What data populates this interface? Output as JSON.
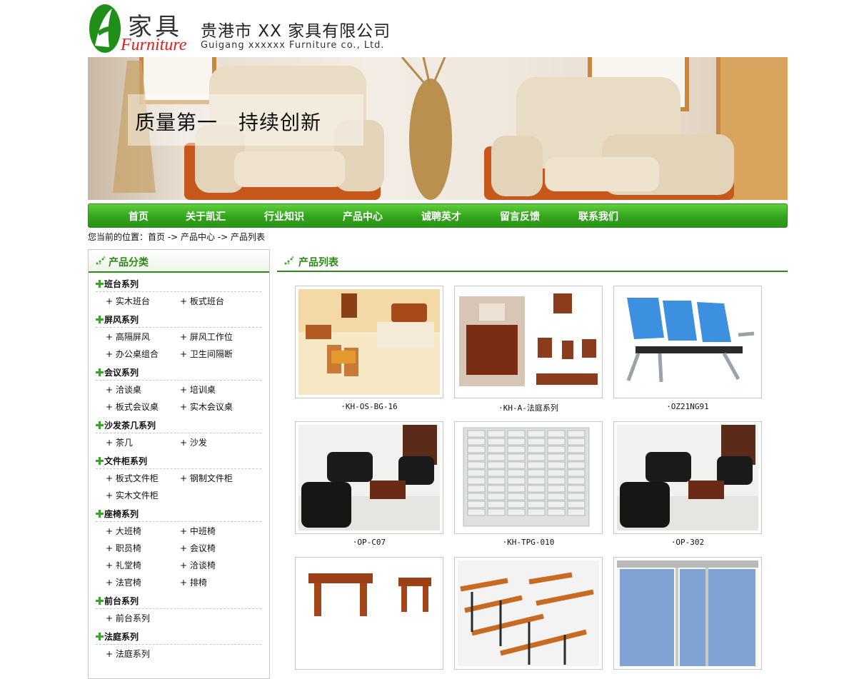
{
  "header": {
    "logo_cn": "家具",
    "logo_en": "Furniture",
    "company_cn": "贵港市 XX 家具有限公司",
    "company_en": "Guigang xxxxxx Furniture co., Ltd."
  },
  "banner": {
    "slogan": "质量第一　持续创新"
  },
  "nav": [
    "首页",
    "关于凯汇",
    "行业知识",
    "产品中心",
    "诚聘英才",
    "留言反馈",
    "联系我们"
  ],
  "breadcrumb": "您当前的位置：首页 -> 产品中心 -> 产品列表",
  "sidebar": {
    "title": "产品分类",
    "categories": [
      {
        "name": "班台系列",
        "items": [
          "实木班台",
          "板式班台"
        ]
      },
      {
        "name": "屏风系列",
        "items": [
          "高隔屏风",
          "屏风工作位",
          "办公桌组合",
          "卫生间隔断"
        ]
      },
      {
        "name": "会议系列",
        "items": [
          "洽谈桌",
          "培训桌",
          "板式会议桌",
          "实木会议桌"
        ]
      },
      {
        "name": "沙发茶几系列",
        "items": [
          "茶几",
          "沙发"
        ]
      },
      {
        "name": "文件柜系列",
        "items": [
          "板式文件柜",
          "钢制文件柜",
          "实木文件柜"
        ]
      },
      {
        "name": "座椅系列",
        "items": [
          "大班椅",
          "中班椅",
          "职员椅",
          "会议椅",
          "礼堂椅",
          "洽谈椅",
          "法官椅",
          "排椅"
        ]
      },
      {
        "name": "前台系列",
        "items": [
          "前台系列"
        ]
      },
      {
        "name": "法庭系列",
        "items": [
          "法庭系列"
        ]
      }
    ]
  },
  "main": {
    "title": "产品列表",
    "products": [
      {
        "caption": "·KH-OS-BG-16",
        "image": "bedroom-set"
      },
      {
        "caption": "·KH-A-法庭系列",
        "image": "courtroom-furniture"
      },
      {
        "caption": "·OZ21NG91",
        "image": "blue-bench-seating"
      },
      {
        "caption": "·OP-C07",
        "image": "leather-sofa-set"
      },
      {
        "caption": "·KH-TPG-010",
        "image": "steel-locker-cabinet"
      },
      {
        "caption": "·OP-302",
        "image": "leather-sofa-set"
      },
      {
        "caption": "",
        "image": "wooden-tables"
      },
      {
        "caption": "",
        "image": "training-desks"
      },
      {
        "caption": "",
        "image": "toilet-partition"
      }
    ]
  },
  "colors": {
    "brand_green": "#2b8a16",
    "nav_green": "#33a41d",
    "logo_red": "#e02020"
  }
}
